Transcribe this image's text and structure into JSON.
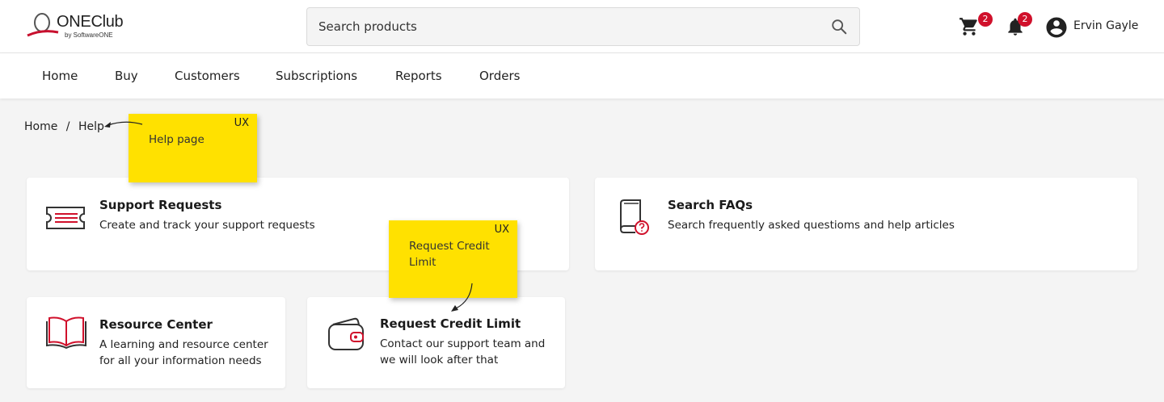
{
  "header": {
    "logo_title": "ONEClub",
    "logo_subtitle": "by SoftwareONE",
    "search_placeholder": "Search products",
    "cart_badge": "2",
    "notifications_badge": "2",
    "user_name": "Ervin Gayle"
  },
  "nav": {
    "items": [
      "Home",
      "Buy",
      "Customers",
      "Subscriptions",
      "Reports",
      "Orders"
    ]
  },
  "breadcrumb": {
    "items": [
      "Home",
      "/",
      "Help"
    ]
  },
  "cards": [
    {
      "title": "Support Requests",
      "description": "Create and track your support requests",
      "icon": "ticket-icon"
    },
    {
      "title": "Search FAQs",
      "description": "Search frequently asked questioms and help articles",
      "icon": "faq-book-icon"
    },
    {
      "title": "Resource Center",
      "description_lines": [
        "A learning and resource center",
        "for all your information needs"
      ],
      "icon": "open-book-icon"
    },
    {
      "title": "Request Credit Limit",
      "description_lines": [
        "Contact our support team and",
        "we will look after that"
      ],
      "icon": "wallet-icon"
    }
  ],
  "stickies": [
    {
      "tag": "UX",
      "text_lines": [
        "Help page"
      ]
    },
    {
      "tag": "UX",
      "text_lines": [
        "Request Credit",
        "Limit"
      ]
    }
  ],
  "colors": {
    "accent": "#d0102b",
    "sticky": "#ffe100",
    "page_bg": "#f4f4f4"
  }
}
